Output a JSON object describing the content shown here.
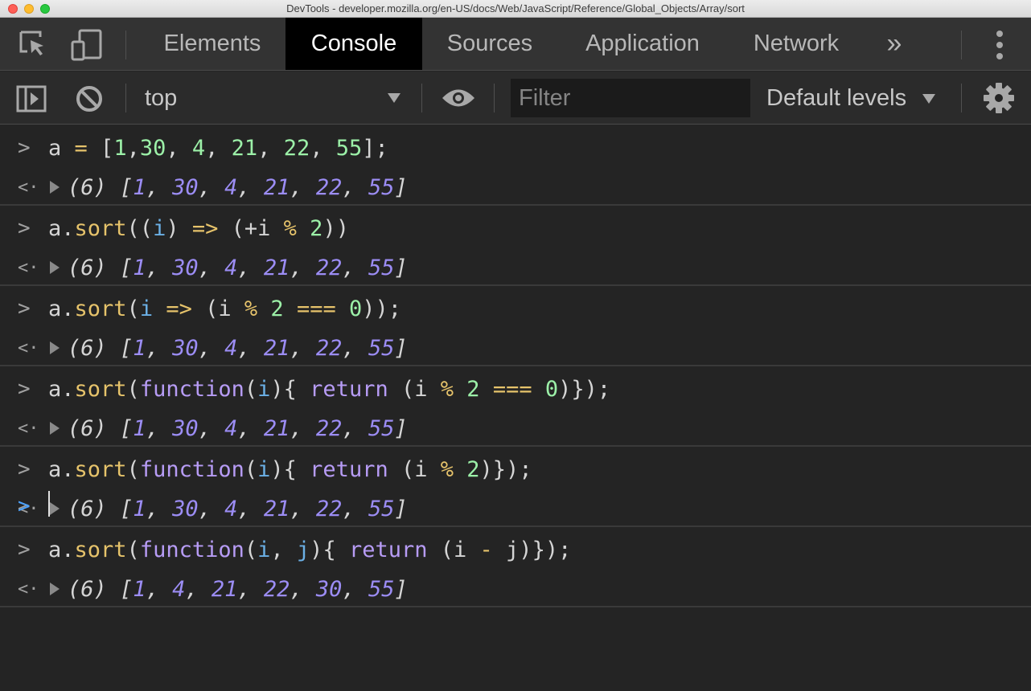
{
  "window": {
    "title": "DevTools - developer.mozilla.org/en-US/docs/Web/JavaScript/Reference/Global_Objects/Array/sort"
  },
  "tabs": [
    {
      "label": "Elements",
      "active": false
    },
    {
      "label": "Console",
      "active": true
    },
    {
      "label": "Sources",
      "active": false
    },
    {
      "label": "Application",
      "active": false
    },
    {
      "label": "Network",
      "active": false
    }
  ],
  "toolbar": {
    "context": "top",
    "filter_placeholder": "Filter",
    "levels": "Default levels"
  },
  "icons": {
    "inspect": "inspect-element-icon",
    "device": "device-toolbar-icon",
    "more_tabs": "double-chevron-right-icon",
    "menu": "vertical-dots-icon",
    "sidebar": "sidebar-toggle-icon",
    "clear": "clear-console-icon",
    "eye": "eye-icon",
    "settings": "gear-icon"
  },
  "colors": {
    "active_tab_bg": "#000000",
    "prompt": "#4da3ff"
  },
  "console": {
    "entries": [
      {
        "input": [
          [
            "a",
            "def"
          ],
          [
            " = ",
            "op"
          ],
          [
            "[",
            "def"
          ],
          [
            "1",
            "num"
          ],
          [
            ",",
            "def"
          ],
          [
            "30",
            "num"
          ],
          [
            ", ",
            "def"
          ],
          [
            "4",
            "num"
          ],
          [
            ", ",
            "def"
          ],
          [
            "21",
            "num"
          ],
          [
            ", ",
            "def"
          ],
          [
            "22",
            "num"
          ],
          [
            ", ",
            "def"
          ],
          [
            "55",
            "num"
          ],
          [
            "];",
            "def"
          ]
        ],
        "output": {
          "count": "(6)",
          "values": [
            "1",
            "30",
            "4",
            "21",
            "22",
            "55"
          ]
        }
      },
      {
        "input": [
          [
            "a.",
            "def"
          ],
          [
            "sort",
            "fn"
          ],
          [
            "((",
            "def"
          ],
          [
            "i",
            "param"
          ],
          [
            ") ",
            "def"
          ],
          [
            "=>",
            "op"
          ],
          [
            " (+i ",
            "def"
          ],
          [
            "%",
            "op"
          ],
          [
            " ",
            "def"
          ],
          [
            "2",
            "num"
          ],
          [
            "))",
            "def"
          ]
        ],
        "output": {
          "count": "(6)",
          "values": [
            "1",
            "30",
            "4",
            "21",
            "22",
            "55"
          ]
        }
      },
      {
        "input": [
          [
            "a.",
            "def"
          ],
          [
            "sort",
            "fn"
          ],
          [
            "(",
            "def"
          ],
          [
            "i",
            "param"
          ],
          [
            " ",
            "def"
          ],
          [
            "=>",
            "op"
          ],
          [
            " (i ",
            "def"
          ],
          [
            "%",
            "op"
          ],
          [
            " ",
            "def"
          ],
          [
            "2",
            "num"
          ],
          [
            " ",
            "def"
          ],
          [
            "===",
            "op"
          ],
          [
            " ",
            "def"
          ],
          [
            "0",
            "num"
          ],
          [
            "));",
            "def"
          ]
        ],
        "output": {
          "count": "(6)",
          "values": [
            "1",
            "30",
            "4",
            "21",
            "22",
            "55"
          ]
        }
      },
      {
        "input": [
          [
            "a.",
            "def"
          ],
          [
            "sort",
            "fn"
          ],
          [
            "(",
            "def"
          ],
          [
            "function",
            "kw"
          ],
          [
            "(",
            "def"
          ],
          [
            "i",
            "param"
          ],
          [
            ")",
            "def"
          ],
          [
            "{ ",
            "def"
          ],
          [
            "return",
            "kw"
          ],
          [
            " (i ",
            "def"
          ],
          [
            "%",
            "op"
          ],
          [
            " ",
            "def"
          ],
          [
            "2",
            "num"
          ],
          [
            " ",
            "def"
          ],
          [
            "===",
            "op"
          ],
          [
            " ",
            "def"
          ],
          [
            "0",
            "num"
          ],
          [
            ")});",
            "def"
          ]
        ],
        "output": {
          "count": "(6)",
          "values": [
            "1",
            "30",
            "4",
            "21",
            "22",
            "55"
          ]
        }
      },
      {
        "input": [
          [
            "a.",
            "def"
          ],
          [
            "sort",
            "fn"
          ],
          [
            "(",
            "def"
          ],
          [
            "function",
            "kw"
          ],
          [
            "(",
            "def"
          ],
          [
            "i",
            "param"
          ],
          [
            ")",
            "def"
          ],
          [
            "{ ",
            "def"
          ],
          [
            "return",
            "kw"
          ],
          [
            " (i ",
            "def"
          ],
          [
            "%",
            "op"
          ],
          [
            " ",
            "def"
          ],
          [
            "2",
            "num"
          ],
          [
            ")});",
            "def"
          ]
        ],
        "output": {
          "count": "(6)",
          "values": [
            "1",
            "30",
            "4",
            "21",
            "22",
            "55"
          ]
        }
      },
      {
        "input": [
          [
            "a.",
            "def"
          ],
          [
            "sort",
            "fn"
          ],
          [
            "(",
            "def"
          ],
          [
            "function",
            "kw"
          ],
          [
            "(",
            "def"
          ],
          [
            "i",
            "param"
          ],
          [
            ", ",
            "def"
          ],
          [
            "j",
            "param"
          ],
          [
            ")",
            "def"
          ],
          [
            "{ ",
            "def"
          ],
          [
            "return",
            "kw"
          ],
          [
            " (i ",
            "def"
          ],
          [
            "-",
            "op"
          ],
          [
            " j)});",
            "def"
          ]
        ],
        "output": {
          "count": "(6)",
          "values": [
            "1",
            "4",
            "21",
            "22",
            "30",
            "55"
          ]
        }
      }
    ]
  }
}
